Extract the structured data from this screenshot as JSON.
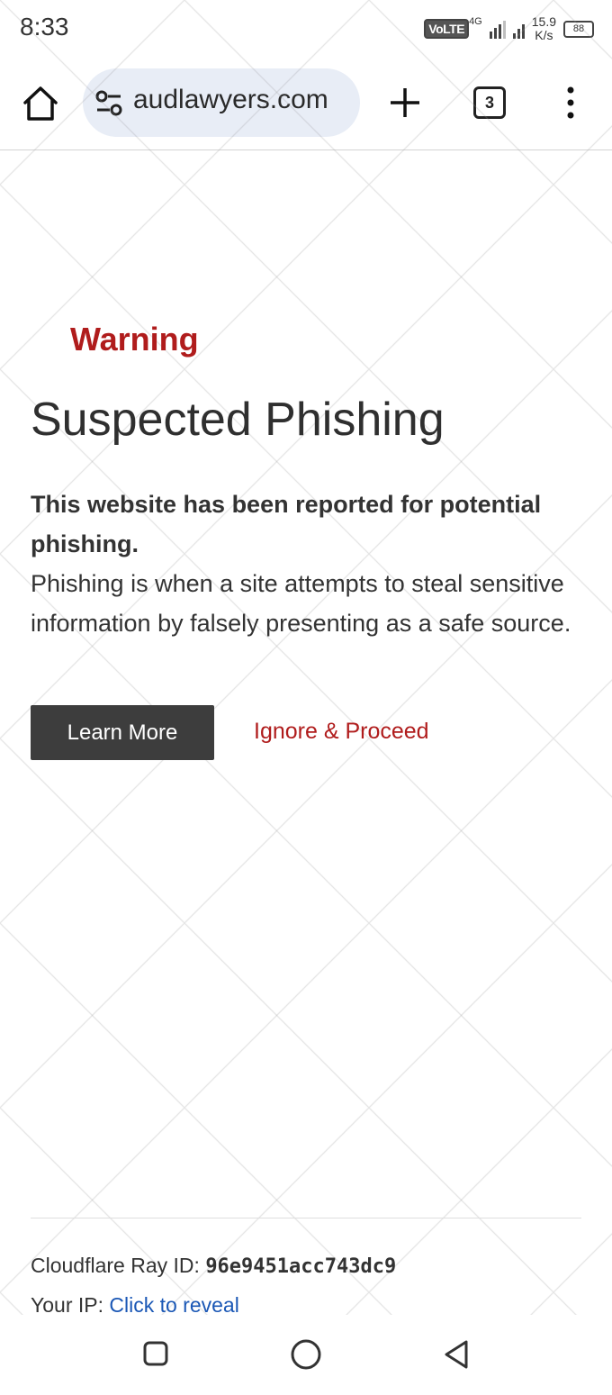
{
  "status_bar": {
    "time": "8:33",
    "network": "VoLTE",
    "network_gen": "4G",
    "speed_value": "15.9",
    "speed_unit": "K/s",
    "battery": "88"
  },
  "toolbar": {
    "url": "audlawyers.com",
    "tab_count": "3"
  },
  "page": {
    "warning": "Warning",
    "title": "Suspected Phishing",
    "lead": "This website has been reported for potential phishing.",
    "body": "Phishing is when a site attempts to steal sensitive information by falsely presenting as a safe source.",
    "learn_more": "Learn More",
    "ignore": "Ignore & Proceed"
  },
  "footer": {
    "ray_label": "Cloudflare Ray ID: ",
    "ray_id": "96e9451acc743dc9",
    "ip_label": "Your IP: ",
    "ip_link": "Click to reveal"
  },
  "colors": {
    "warning_red": "#b01c1c",
    "button_dark": "#3d3d3d",
    "link_blue": "#1a57b5",
    "url_pill": "#e8edf6"
  }
}
